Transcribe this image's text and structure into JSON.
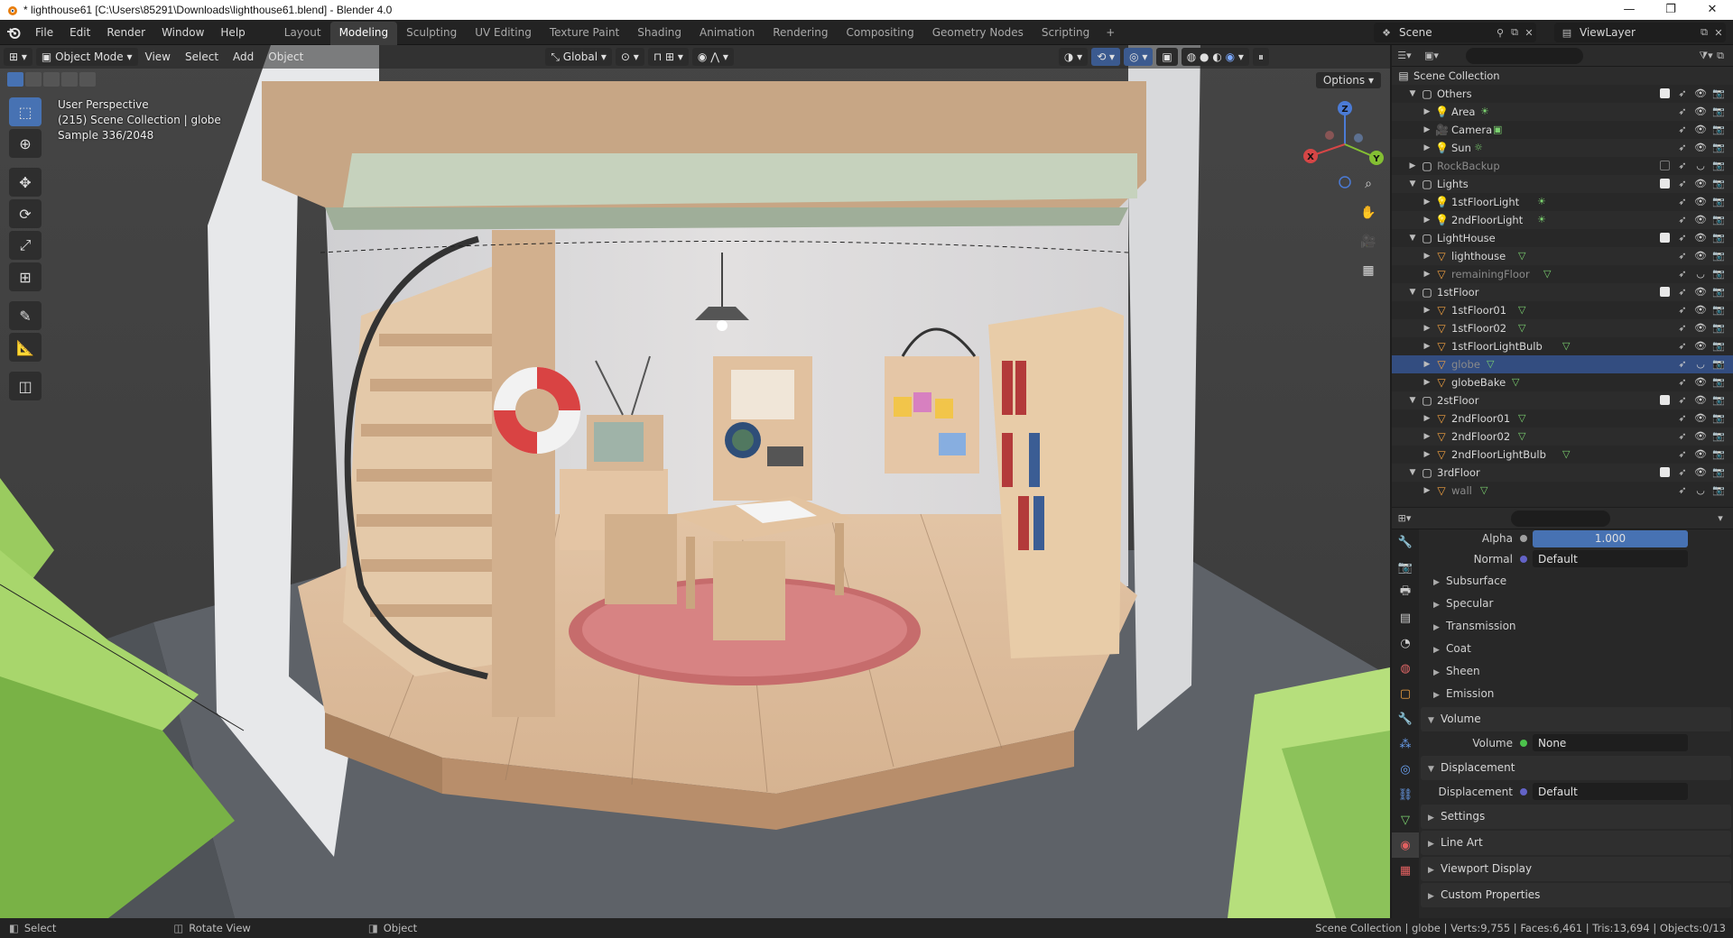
{
  "window": {
    "title": "* lighthouse61 [C:\\Users\\85291\\Downloads\\lighthouse61.blend] - Blender 4.0",
    "controls": [
      "—",
      "❐",
      "✕"
    ]
  },
  "menu": [
    "File",
    "Edit",
    "Render",
    "Window",
    "Help"
  ],
  "workspaces": [
    "Layout",
    "Modeling",
    "Sculpting",
    "UV Editing",
    "Texture Paint",
    "Shading",
    "Animation",
    "Rendering",
    "Compositing",
    "Geometry Nodes",
    "Scripting"
  ],
  "active_workspace": "Modeling",
  "scene": "Scene",
  "view_layer": "ViewLayer",
  "viewport": {
    "mode": "Object Mode",
    "menus": [
      "View",
      "Select",
      "Add",
      "Object"
    ],
    "orientation": "Global",
    "options_label": "Options",
    "info": [
      "User Perspective",
      "(215) Scene Collection | globe",
      "Sample 336/2048"
    ],
    "gizmo_axes": [
      "X",
      "Y",
      "Z"
    ]
  },
  "outliner": {
    "root": "Scene Collection",
    "rows": [
      {
        "label": "Others",
        "type": "collection",
        "depth": 1,
        "expanded": true,
        "check": true
      },
      {
        "label": "Area",
        "type": "light",
        "depth": 2,
        "badge": "light-data"
      },
      {
        "label": "Camera",
        "type": "camera",
        "depth": 2,
        "badge": "camera-data"
      },
      {
        "label": "Sun",
        "type": "light",
        "depth": 2,
        "badge": "sun-data"
      },
      {
        "label": "RockBackup",
        "type": "collection",
        "depth": 1,
        "dim": true,
        "check": false
      },
      {
        "label": "Lights",
        "type": "collection",
        "depth": 1,
        "expanded": true,
        "check": true
      },
      {
        "label": "1stFloorLight",
        "type": "light",
        "depth": 2,
        "badge": "light-data"
      },
      {
        "label": "2ndFloorLight",
        "type": "light",
        "depth": 2,
        "badge": "light-data"
      },
      {
        "label": "LightHouse",
        "type": "collection",
        "depth": 1,
        "expanded": true,
        "check": true
      },
      {
        "label": "lighthouse",
        "type": "mesh",
        "depth": 2,
        "badge": "mesh-data"
      },
      {
        "label": "remainingFloor",
        "type": "mesh",
        "depth": 2,
        "dim": true,
        "badge": "mesh-data"
      },
      {
        "label": "1stFloor",
        "type": "collection",
        "depth": 1,
        "expanded": true,
        "check": true
      },
      {
        "label": "1stFloor01",
        "type": "mesh",
        "depth": 2,
        "badge": "mesh-data"
      },
      {
        "label": "1stFloor02",
        "type": "mesh",
        "depth": 2,
        "badge": "mesh-data"
      },
      {
        "label": "1stFloorLightBulb",
        "type": "mesh",
        "depth": 2,
        "badge": "mesh-data"
      },
      {
        "label": "globe",
        "type": "mesh",
        "depth": 2,
        "selected": true,
        "dim": true,
        "badge": "mesh-data"
      },
      {
        "label": "globeBake",
        "type": "mesh",
        "depth": 2,
        "badge": "mesh-data"
      },
      {
        "label": "2stFloor",
        "type": "collection",
        "depth": 1,
        "expanded": true,
        "check": true
      },
      {
        "label": "2ndFloor01",
        "type": "mesh",
        "depth": 2,
        "badge": "mesh-data"
      },
      {
        "label": "2ndFloor02",
        "type": "mesh",
        "depth": 2,
        "badge": "mesh-data"
      },
      {
        "label": "2ndFloorLightBulb",
        "type": "mesh",
        "depth": 2,
        "badge": "mesh-data"
      },
      {
        "label": "3rdFloor",
        "type": "collection",
        "depth": 1,
        "expanded": true,
        "check": true
      },
      {
        "label": "wall",
        "type": "mesh",
        "depth": 2,
        "dim": true,
        "badge": "mesh-data"
      }
    ]
  },
  "properties": {
    "alpha_label": "Alpha",
    "alpha_value": "1.000",
    "normal_label": "Normal",
    "normal_value": "Default",
    "subpanels": [
      "Subsurface",
      "Specular",
      "Transmission",
      "Coat",
      "Sheen",
      "Emission"
    ],
    "volume_panel": "Volume",
    "volume_label": "Volume",
    "volume_value": "None",
    "displacement_panel": "Displacement",
    "displacement_label": "Displacement",
    "displacement_value": "Default",
    "closed_panels": [
      "Settings",
      "Line Art",
      "Viewport Display",
      "Custom Properties"
    ]
  },
  "statusbar": {
    "items": [
      "Select",
      "Rotate View",
      "Object"
    ],
    "stats": "Scene Collection | globe | Verts:9,755 | Faces:6,461 | Tris:13,694 | Objects:0/13"
  }
}
